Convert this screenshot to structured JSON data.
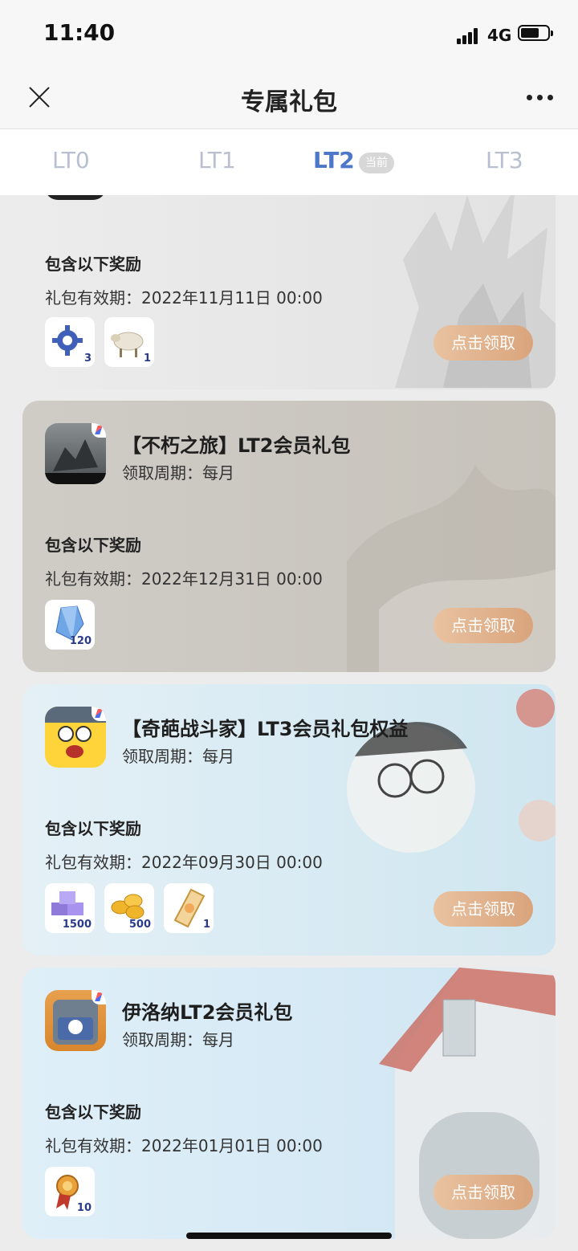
{
  "status_bar": {
    "time": "11:40",
    "network": "4G"
  },
  "nav": {
    "title": "专属礼包"
  },
  "tabs": [
    {
      "label": "LT0"
    },
    {
      "label": "LT1"
    },
    {
      "label": "LT2",
      "badge": "当前",
      "active": true
    },
    {
      "label": "LT3"
    }
  ],
  "cards": [
    {
      "title": "",
      "cycle": "",
      "reward_heading": "包含以下奖励",
      "validity": "礼包有效期：2022年11月11日 00:00",
      "rewards": [
        {
          "icon": "gear-crystal-icon",
          "count": "3"
        },
        {
          "icon": "sheep-icon",
          "count": "1"
        }
      ],
      "claim": "点击领取"
    },
    {
      "title": "【不朽之旅】LT2会员礼包",
      "cycle": "领取周期：每月",
      "reward_heading": "包含以下奖励",
      "validity": "礼包有效期：2022年12月31日 00:00",
      "rewards": [
        {
          "icon": "blue-crystal-icon",
          "count": "120"
        }
      ],
      "claim": "点击领取"
    },
    {
      "title": "【奇葩战斗家】LT3会员礼包权益",
      "cycle": "领取周期：每月",
      "reward_heading": "包含以下奖励",
      "validity": "礼包有效期：2022年09月30日 00:00",
      "rewards": [
        {
          "icon": "purple-cubes-icon",
          "count": "1500"
        },
        {
          "icon": "gold-coins-icon",
          "count": "500"
        },
        {
          "icon": "ticket-icon",
          "count": "1"
        }
      ],
      "claim": "点击领取"
    },
    {
      "title": "伊洛纳LT2会员礼包",
      "cycle": "领取周期：每月",
      "reward_heading": "包含以下奖励",
      "validity": "礼包有效期：2022年01月01日 00:00",
      "rewards": [
        {
          "icon": "medal-icon",
          "count": "10"
        }
      ],
      "claim": "点击领取"
    }
  ]
}
